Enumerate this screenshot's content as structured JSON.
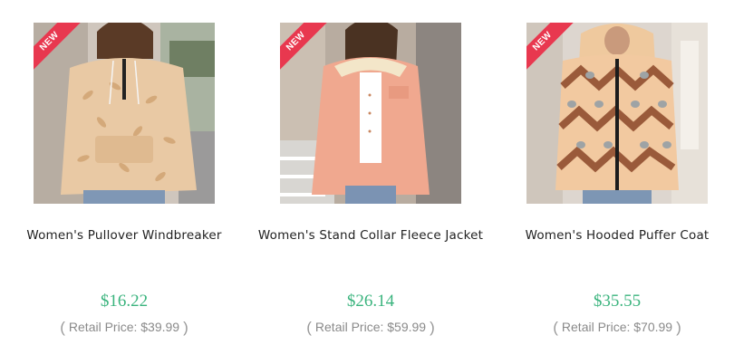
{
  "products": [
    {
      "badge": "NEW",
      "name": "Women's Pullover Windbreaker",
      "price": "$16.22",
      "retail_label": "Retail Price: $39.99",
      "image_icon": "product-photo-pullover-windbreaker"
    },
    {
      "badge": "NEW",
      "name": "Women's Stand Collar Fleece Jacket",
      "price": "$26.14",
      "retail_label": "Retail Price: $59.99",
      "image_icon": "product-photo-fleece-jacket"
    },
    {
      "badge": "NEW",
      "name": "Women's Hooded Puffer Coat",
      "price": "$35.55",
      "retail_label": "Retail Price: $70.99",
      "image_icon": "product-photo-puffer-coat"
    }
  ],
  "paren_open": "(",
  "paren_close": ")",
  "colors": {
    "price": "#3bb47e",
    "badge": "#e8384f",
    "retail": "#8a8a8a"
  }
}
